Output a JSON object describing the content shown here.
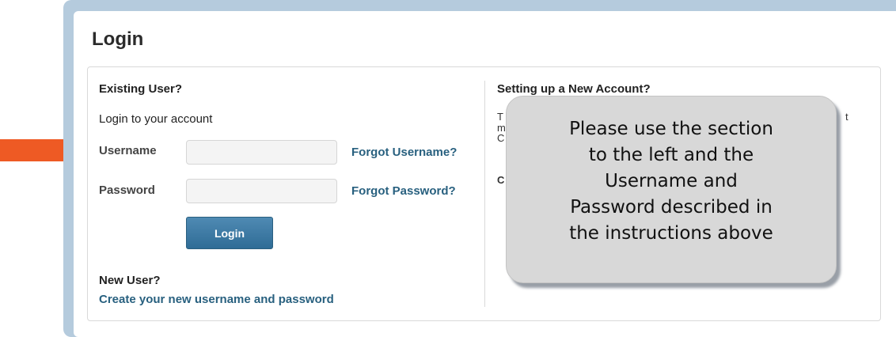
{
  "login": {
    "title": "Login",
    "existing_heading": "Existing User?",
    "subtitle": "Login to your account",
    "username_label": "Username",
    "password_label": "Password",
    "username_value": "",
    "password_value": "",
    "forgot_username": "Forgot Username?",
    "forgot_password": "Forgot Password?",
    "login_button": "Login",
    "new_user_heading": "New User?",
    "create_link": "Create your new username and password"
  },
  "new_account": {
    "heading": "Setting up a New Account?",
    "visible_fragments": [
      "T",
      "m",
      "C",
      "C",
      "t"
    ]
  },
  "callout": {
    "text": "Please use the section\nto the left and the\nUsername and\nPassword described in\nthe instructions above"
  },
  "colors": {
    "frame": "#b5cbdd",
    "link": "#28607f",
    "button": "#3a78a3",
    "arrow": "#ee5a24",
    "callout": "#d8d8d8"
  }
}
